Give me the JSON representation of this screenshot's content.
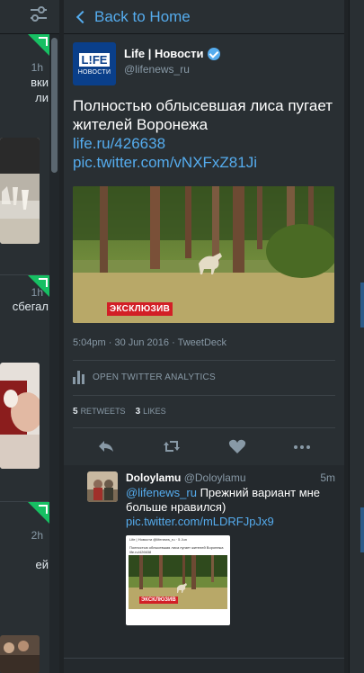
{
  "left_column": {
    "items": [
      {
        "time": "1h",
        "text_lines": [
          "вки",
          "ли"
        ]
      },
      {
        "time": "1h",
        "text_lines": [
          "сбегал"
        ]
      },
      {
        "time": "2h",
        "text_lines": [
          "ей"
        ]
      }
    ]
  },
  "header": {
    "back_label": "Back to Home"
  },
  "tweet": {
    "author_name": "Life | Новости",
    "author_handle": "@lifenews_ru",
    "logo_top": "L!FE",
    "logo_bottom": "НОВОСТИ",
    "text": "Полностью облысевшая лиса пугает жителей Воронежа",
    "link_1": "life.ru/426638",
    "link_2": "pic.twitter.com/vNXFxZ81Ji",
    "photo_badge": "ЭКСКЛЮЗИВ",
    "meta": "5:04pm · 30 Jun 2016 · TweetDeck",
    "analytics_label": "OPEN TWITTER ANALYTICS",
    "retweets_count": "5",
    "retweets_label": "RETWEETS",
    "likes_count": "3",
    "likes_label": "LIKES"
  },
  "reply": {
    "name": "Doloylamu",
    "handle": "@Doloylamu",
    "time": "5m",
    "mention": "@lifenews_ru",
    "text": " Прежний вариант мне больше нравился)",
    "link": "pic.twitter.com/mLDRFJpJx9",
    "thumb_header": "Life | Новости @lifenews_ru · 5 Jun",
    "thumb_caption": "Полностью облысевшая лиса пугает жителей Воронежа life.ru/426638",
    "thumb_badge": "ЭКСКЛЮЗИВ"
  },
  "colors": {
    "accent": "#55acee",
    "background": "#292f33",
    "badge": "#d21f26",
    "new_marker": "#17bf63"
  }
}
